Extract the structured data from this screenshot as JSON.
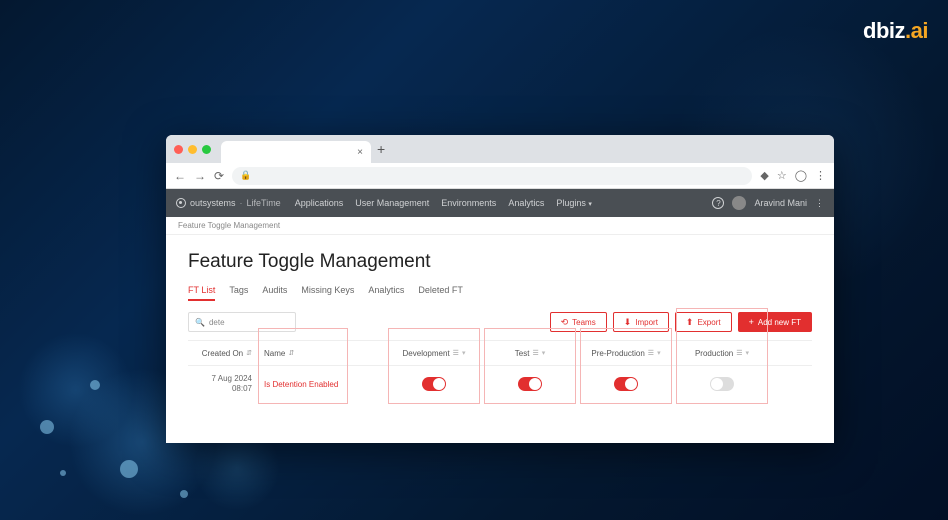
{
  "brand": {
    "name": "dbiz",
    "suffix": ".ai"
  },
  "browser": {
    "close": "×",
    "newtab": "+",
    "lock": "🔒"
  },
  "header": {
    "product": "outsystems",
    "sub": "LifeTime",
    "nav": [
      "Applications",
      "User Management",
      "Environments",
      "Analytics",
      "Plugins"
    ],
    "user": "Aravind Mani"
  },
  "breadcrumb": "Feature Toggle Management",
  "page": {
    "title": "Feature Toggle Management"
  },
  "tabs": [
    {
      "label": "FT List",
      "active": true
    },
    {
      "label": "Tags",
      "active": false
    },
    {
      "label": "Audits",
      "active": false
    },
    {
      "label": "Missing Keys",
      "active": false
    },
    {
      "label": "Analytics",
      "active": false
    },
    {
      "label": "Deleted FT",
      "active": false
    }
  ],
  "search": {
    "value": "dete"
  },
  "toolbar": {
    "teams": "Teams",
    "import": "Import",
    "export": "Export",
    "add": "Add new FT"
  },
  "columns": {
    "created": "Created On",
    "name": "Name",
    "envs": [
      "Development",
      "Test",
      "Pre-Production",
      "Production"
    ]
  },
  "rows": [
    {
      "date": "7 Aug 2024",
      "time": "08:07",
      "name": "Is Detention Enabled",
      "states": [
        "on",
        "on",
        "on",
        "off"
      ]
    }
  ]
}
